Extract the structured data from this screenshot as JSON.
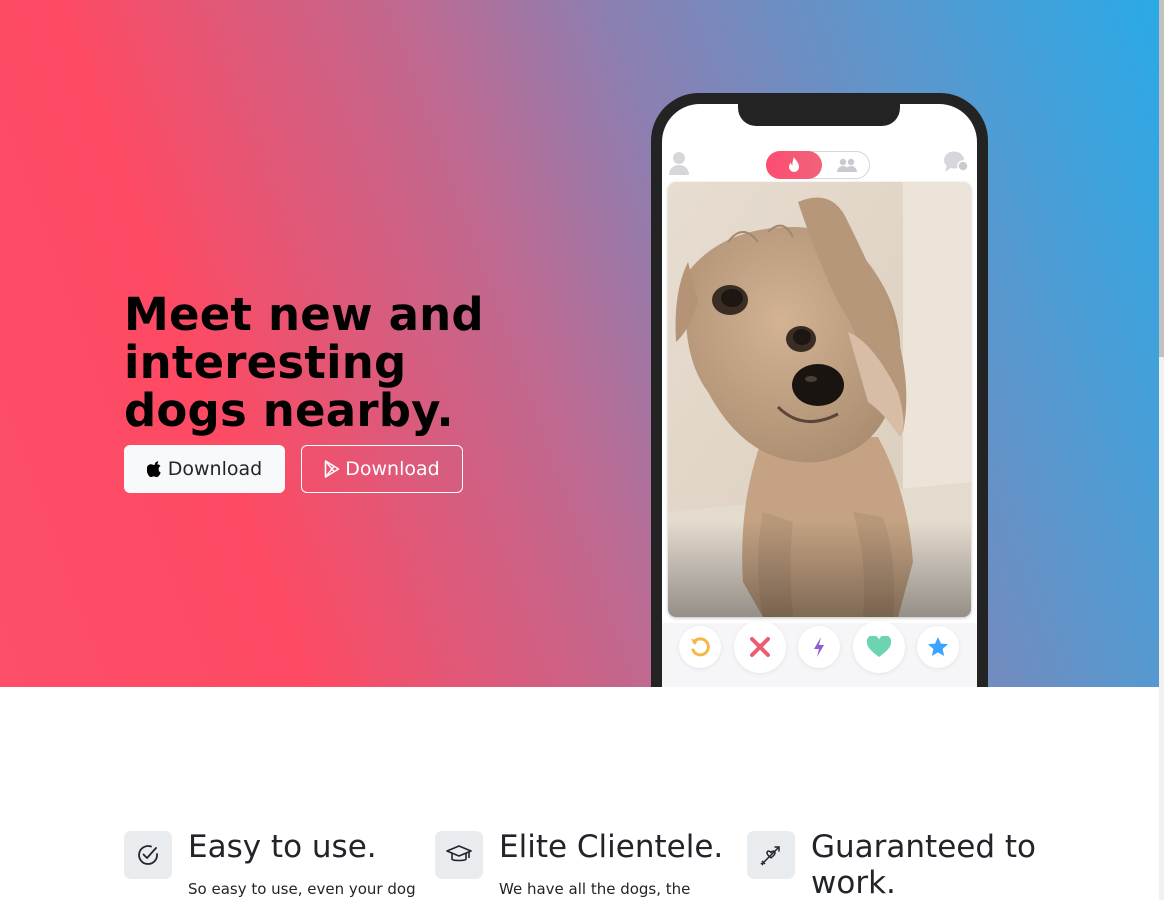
{
  "hero": {
    "headline": "Meet new and interesting dogs nearby.",
    "apple_button": {
      "label": "Download",
      "icon": "apple-icon"
    },
    "play_button": {
      "label": "Download",
      "icon": "google-play-icon"
    }
  },
  "phone": {
    "toggle": {
      "active_icon": "flame-icon",
      "inactive_icon": "group-icon"
    },
    "profile_icon": "profile-icon",
    "chat_icon": "chat-icon",
    "card_photo": "dog-photo",
    "actions": [
      "rewind-icon",
      "nope-icon",
      "boost-icon",
      "like-icon",
      "super-like-icon"
    ]
  },
  "features": [
    {
      "icon": "check-circle-icon",
      "title": "Easy to use.",
      "text": "So easy to use, even your dog"
    },
    {
      "icon": "graduation-cap-icon",
      "title": "Elite Clientele.",
      "text": "We have all the dogs, the"
    },
    {
      "icon": "arrow-heart-icon",
      "title": "Guaranteed to work.",
      "text": ""
    }
  ],
  "colors": {
    "hero_gradient_start": "#fe4a63",
    "hero_gradient_mid": "#c0688f",
    "hero_gradient_end": "#2aaae7",
    "brand_pink": "#fd4c71",
    "nope_red": "#ec5e6f",
    "boost_purple": "#915dd1",
    "like_green": "#6cd4b2",
    "super_like_blue": "#3ca4ff",
    "rewind_yellow": "#f5b748"
  }
}
